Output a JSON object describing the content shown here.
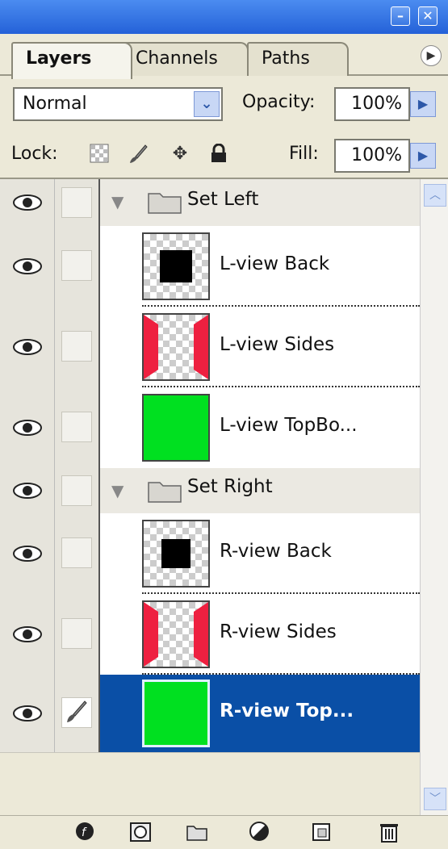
{
  "tabs": [
    "Layers",
    "Channels",
    "Paths"
  ],
  "blend_mode": "Normal",
  "opacity_label": "Opacity:",
  "opacity_value": "100%",
  "lock_label": "Lock:",
  "fill_label": "Fill:",
  "fill_value": "100%",
  "layers": [
    {
      "type": "group",
      "name": "Set Left"
    },
    {
      "type": "layer",
      "name": "L-view Back",
      "thumb": "back"
    },
    {
      "type": "layer",
      "name": "L-view Sides",
      "thumb": "sides"
    },
    {
      "type": "layer",
      "name": "L-view TopBo...",
      "thumb": "green"
    },
    {
      "type": "group",
      "name": "Set Right"
    },
    {
      "type": "layer",
      "name": "R-view Back",
      "thumb": "back"
    },
    {
      "type": "layer",
      "name": "R-view Sides",
      "thumb": "sides"
    },
    {
      "type": "layer",
      "name": "R-view Top...",
      "thumb": "green",
      "selected": true
    }
  ],
  "colors": {
    "selection": "#0a4fa6",
    "thumb_green": "#00e020",
    "thumb_red": "#ee2040",
    "title_blue": "#2461d8"
  },
  "icons": [
    "minimize-icon",
    "close-icon",
    "panel-menu-icon",
    "lock-transparent-icon",
    "lock-brush-icon",
    "lock-move-icon",
    "lock-all-icon",
    "eye-icon",
    "brush-link-icon",
    "folder-icon",
    "layer-style-icon",
    "mask-icon",
    "new-group-icon",
    "adjustment-icon",
    "new-layer-icon",
    "trash-icon"
  ]
}
